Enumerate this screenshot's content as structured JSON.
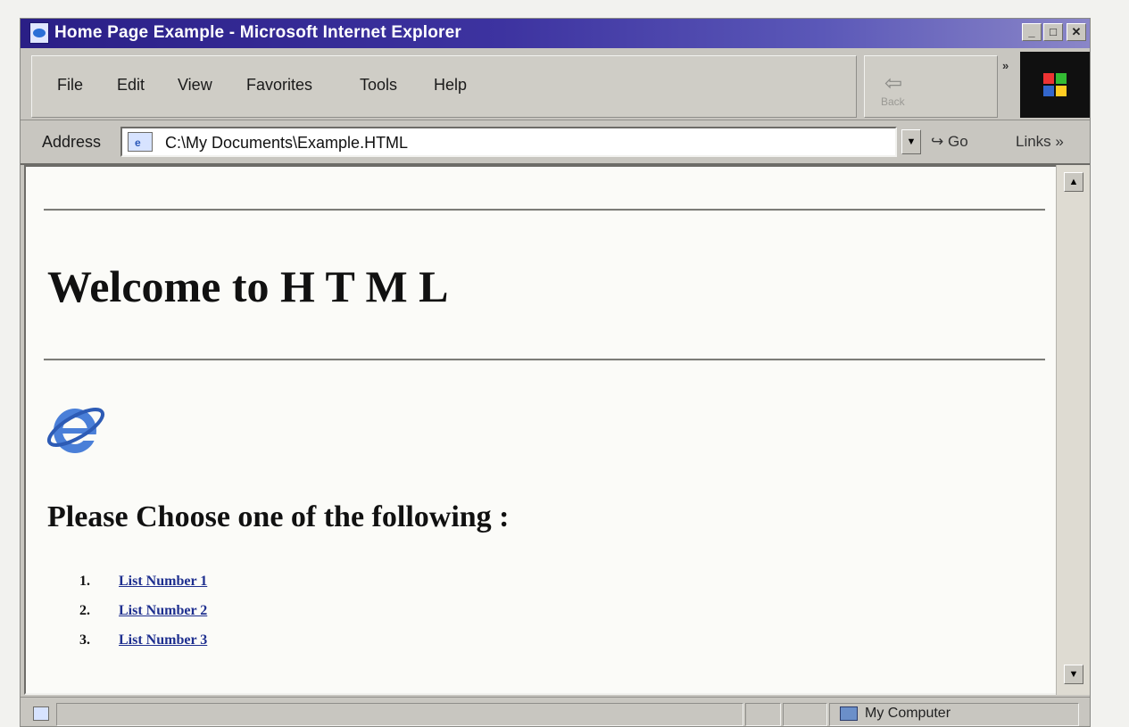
{
  "window": {
    "title": "Home Page Example - Microsoft Internet Explorer",
    "controls": {
      "minimize": "_",
      "maximize": "□",
      "close": "✕"
    }
  },
  "menubar": {
    "items": [
      {
        "label": "File"
      },
      {
        "label": "Edit"
      },
      {
        "label": "View"
      },
      {
        "label": "Favorites"
      },
      {
        "label": "Tools"
      },
      {
        "label": "Help"
      }
    ],
    "overflow": "»"
  },
  "toolbar": {
    "back_label": "Back",
    "back_icon": "back-arrow-icon"
  },
  "address": {
    "label": "Address",
    "value": "C:\\My Documents\\Example.HTML",
    "go_label": "Go",
    "links_label": "Links »"
  },
  "page": {
    "heading": "Welcome to H T M L",
    "subheading": "Please Choose one of the following :",
    "list": [
      {
        "num": "1.",
        "label": "List Number 1"
      },
      {
        "num": "2.",
        "label": "List Number 2"
      },
      {
        "num": "3.",
        "label": "List Number 3"
      }
    ]
  },
  "status": {
    "zone": "My Computer"
  },
  "colors": {
    "titlebar": "#2a1f86",
    "link": "#1e2f8f",
    "window": "#c8c6c0"
  }
}
